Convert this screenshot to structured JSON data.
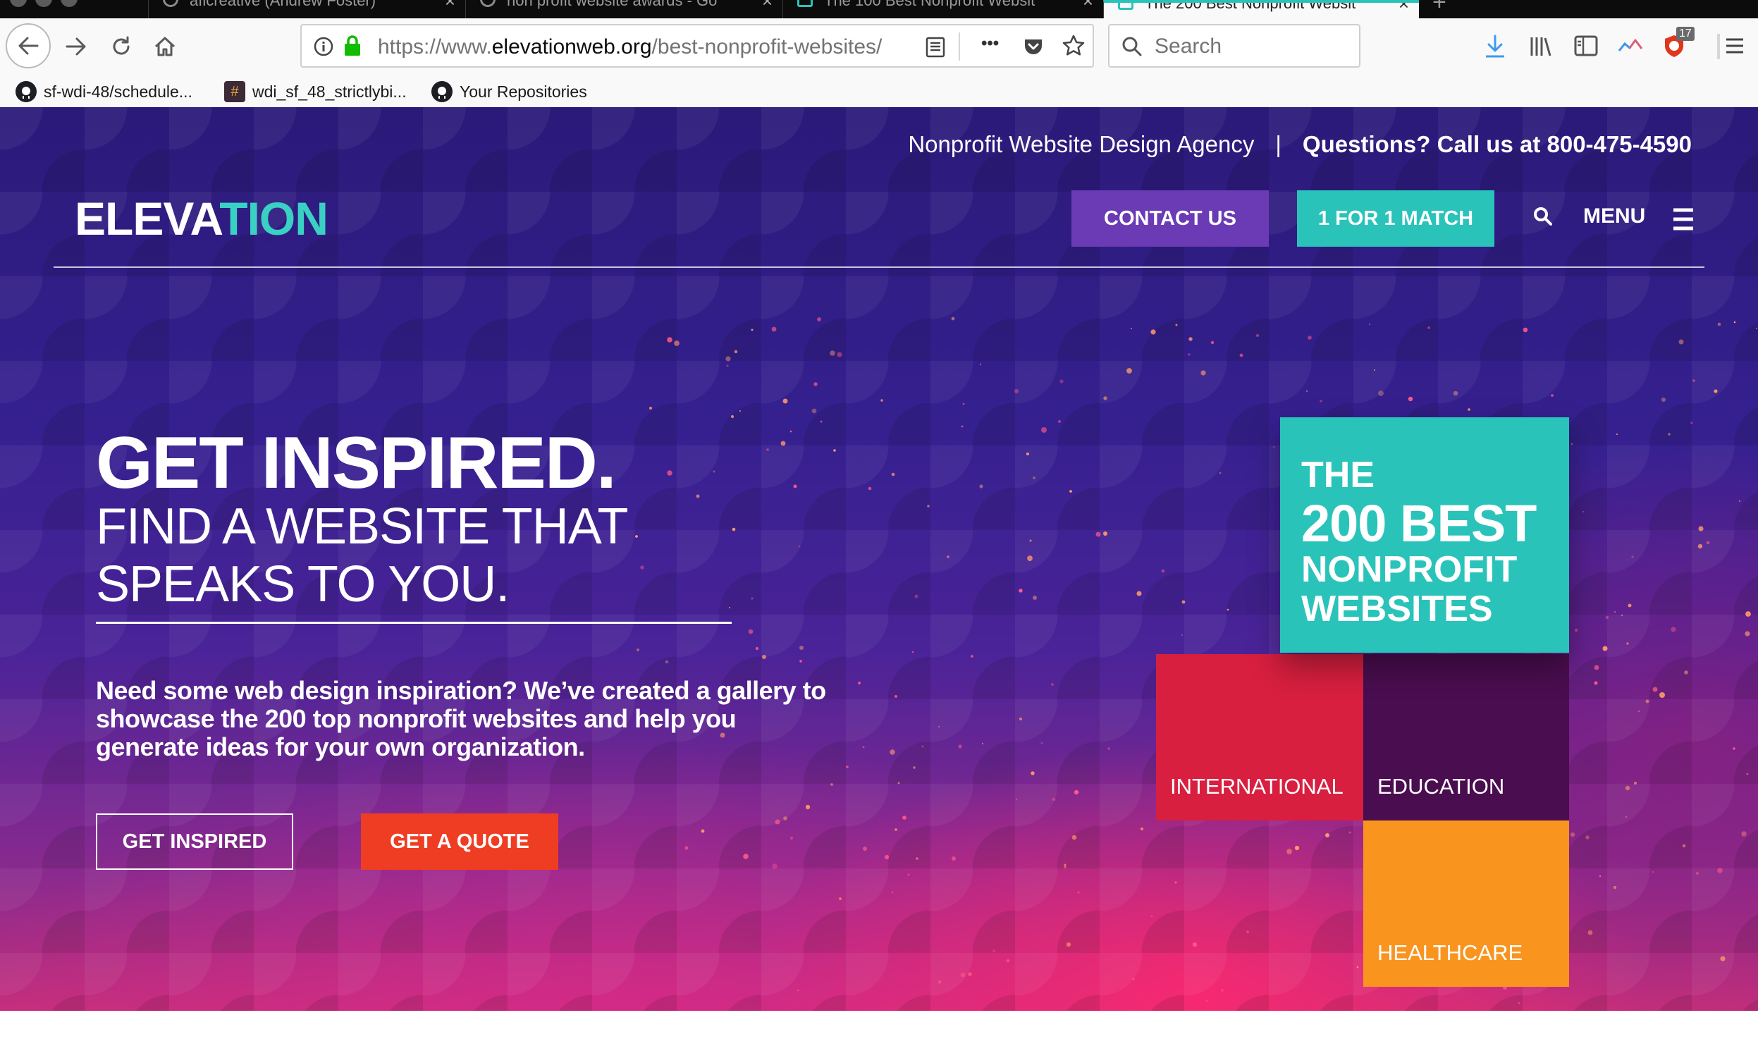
{
  "browser": {
    "tabs": [
      {
        "title": "aficreative (Andrew Foster)",
        "active": false
      },
      {
        "title": "non profit website awards - Go",
        "active": false
      },
      {
        "title": "The 100 Best Nonprofit Websit",
        "active": false
      },
      {
        "title": "The 200 Best Nonprofit Websit",
        "active": true
      }
    ],
    "close_glyph": "×",
    "new_tab_glyph": "+",
    "url": {
      "prefix": "https://www.",
      "domain": "elevationweb.org",
      "path": "/best-nonprofit-websites/"
    },
    "search_placeholder": "Search",
    "overflow_glyph": "•••",
    "badge_count": "17",
    "bookmarks": [
      {
        "label": "sf-wdi-48/schedule...",
        "icon": "github-icon"
      },
      {
        "label": "wdi_sf_48_strictlybi...",
        "icon": "slack-icon"
      },
      {
        "label": "Your Repositories",
        "icon": "github-icon"
      }
    ],
    "slack_glyph": "#"
  },
  "site": {
    "utility_tagline": "Nonprofit Website Design Agency",
    "utility_separator": "|",
    "utility_phone": "Questions? Call us at 800-475-4590",
    "logo_part1": "ELEVA",
    "logo_part2": "TION",
    "nav": {
      "contact": "CONTACT US",
      "match": "1 FOR 1 MATCH",
      "menu": "MENU"
    },
    "hero": {
      "headline": "GET INSPIRED.",
      "subhead": "FIND A WEBSITE THAT SPEAKS TO YOU.",
      "description": "Need some web design inspiration? We’ve created a gallery to showcase the 200 top nonprofit websites and help you generate ideas for your own organization.",
      "btn_inspired": "GET INSPIRED",
      "btn_quote": "GET A QUOTE"
    },
    "promo": {
      "line1": "THE",
      "line2": "200 BEST",
      "line3": "NONPROFIT",
      "line4": "WEBSITES"
    },
    "categories": {
      "international": "INTERNATIONAL",
      "education": "EDUCATION",
      "healthcare": "HEALTHCARE"
    }
  },
  "colors": {
    "teal": "#2ac3ba",
    "purple_button": "#6a3bb5",
    "quote_orange_red": "#ef3d23",
    "international_red": "#d81f3f",
    "education_purple": "#4a0d4f",
    "healthcare_orange": "#f9941e"
  }
}
